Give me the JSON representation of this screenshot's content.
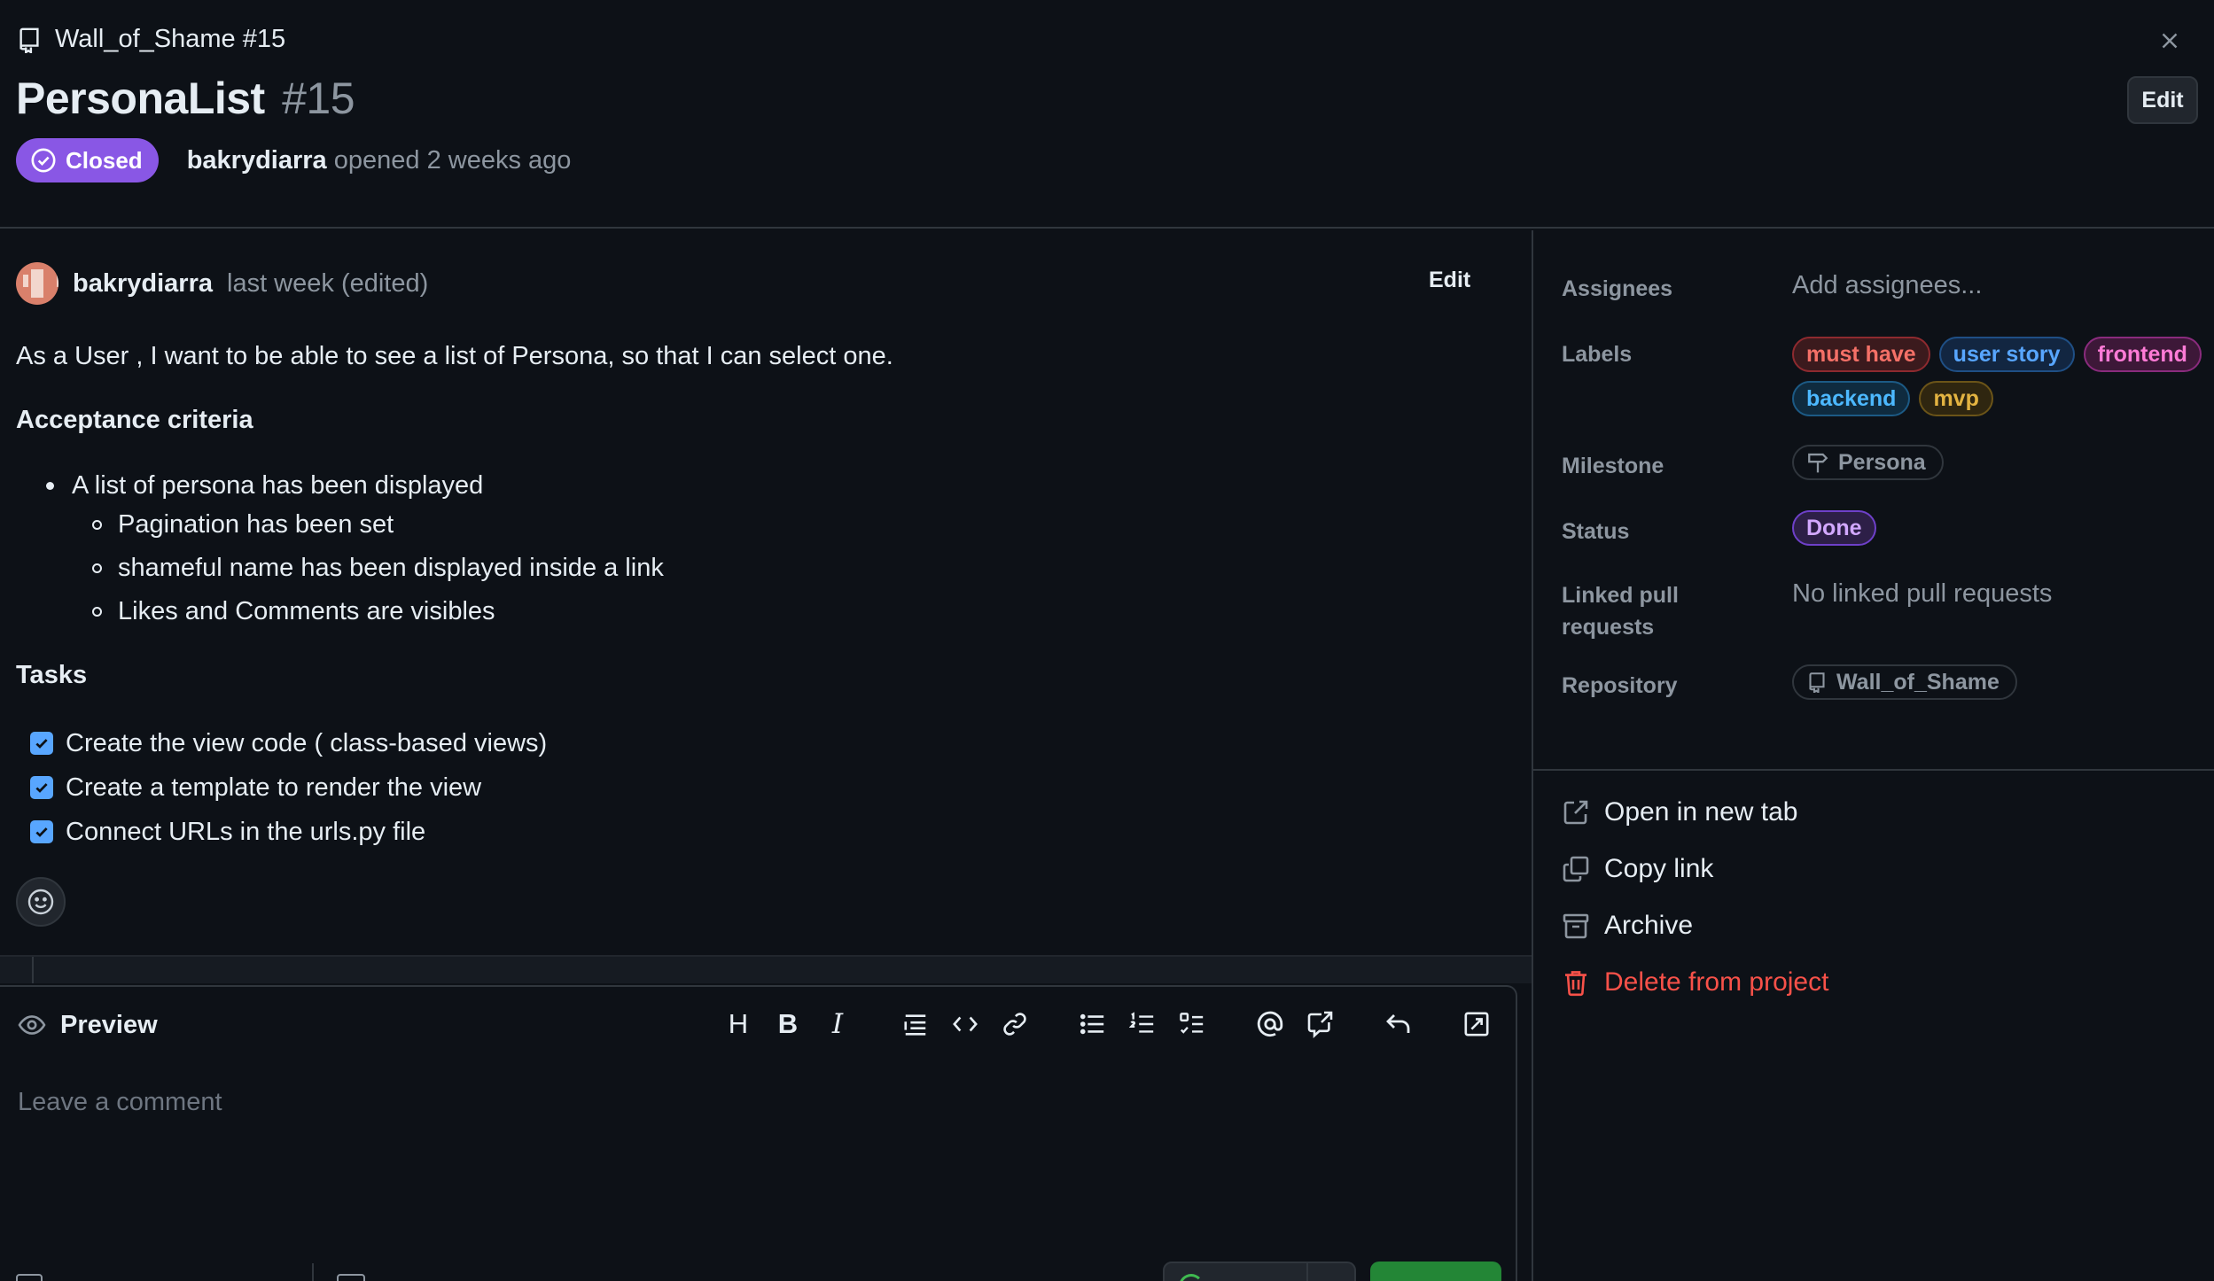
{
  "header": {
    "breadcrumb": "Wall_of_Shame #15",
    "title": "PersonaList",
    "number": "#15",
    "edit_label": "Edit",
    "status": "Closed",
    "author": "bakrydiarra",
    "opened_text": "opened 2 weeks ago"
  },
  "comment": {
    "author": "bakrydiarra",
    "time": "last week (edited)",
    "edit_label": "Edit",
    "intro": "As a User , I want to be able to see a list of Persona, so that I can select one.",
    "acceptance_heading": "Acceptance criteria",
    "bullet": "A list of persona has been displayed",
    "sub_bullets": [
      "Pagination has been set",
      "shameful name has been displayed inside a link",
      "Likes and Comments are visibles"
    ],
    "tasks_heading": "Tasks",
    "tasks": [
      "Create the view code ( class-based views)",
      "Create a template to render the view",
      "Connect URLs in the urls.py file"
    ]
  },
  "editor": {
    "preview_label": "Preview",
    "placeholder": "Leave a comment",
    "toolbar": [
      "heading",
      "bold",
      "italic",
      "quote",
      "code",
      "link",
      "bulleted-list",
      "numbered-list",
      "task-list",
      "mention",
      "reference",
      "undo",
      "fullscreen"
    ]
  },
  "sidebar": {
    "assignees_label": "Assignees",
    "assignees_value": "Add assignees...",
    "labels_label": "Labels",
    "labels": [
      {
        "name": "must have",
        "color": "#f47067",
        "bg": "#3b1a1d",
        "border": "#8e2a2f"
      },
      {
        "name": "user story",
        "color": "#58a6ff",
        "bg": "#122641",
        "border": "#1f4f85"
      },
      {
        "name": "frontend",
        "color": "#ff7bd6",
        "bg": "#3d1838",
        "border": "#8a2b7d"
      },
      {
        "name": "backend",
        "color": "#4cb8ff",
        "bg": "#0f2b3f",
        "border": "#1c5a85"
      },
      {
        "name": "mvp",
        "color": "#e3b341",
        "bg": "#2f2610",
        "border": "#6b5418"
      }
    ],
    "milestone_label": "Milestone",
    "milestone_value": "Persona",
    "status_label": "Status",
    "status_value": "Done",
    "linked_label_1": "Linked pull",
    "linked_label_2": "requests",
    "linked_value": "No linked pull requests",
    "repository_label": "Repository",
    "repository_value": "Wall_of_Shame",
    "actions": {
      "open_new_tab": "Open in new tab",
      "copy_link": "Copy link",
      "archive": "Archive",
      "delete": "Delete from project"
    }
  },
  "colors": {
    "background": "#0d1117",
    "closed_badge": "#8957e5",
    "danger": "#f85149",
    "checkbox": "#58a6ff",
    "comment_button": "#238636"
  }
}
